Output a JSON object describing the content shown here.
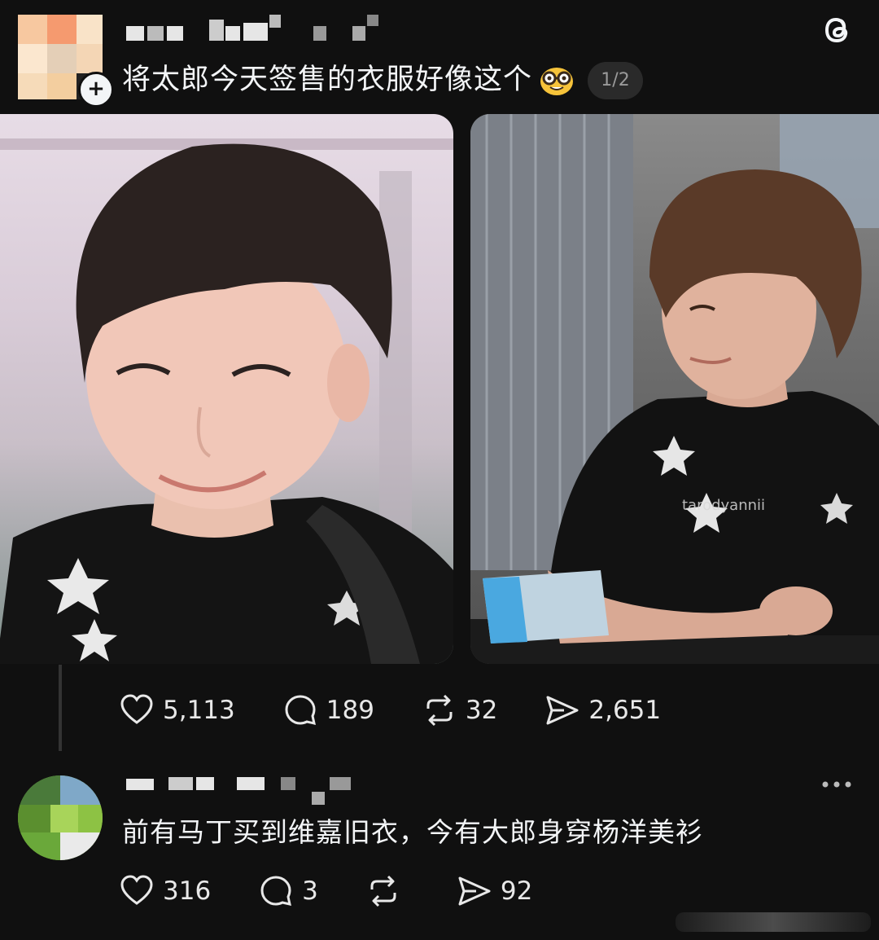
{
  "post": {
    "text": "将太郎今天签售的衣服好像这个",
    "emoji": "nerd-face-emoji",
    "page_indicator": "1/2",
    "media": [
      {
        "name": "photo-left"
      },
      {
        "name": "photo-right",
        "watermark": "tarodyannii"
      }
    ],
    "stats": {
      "likes": "5,113",
      "comments": "189",
      "reposts": "32",
      "shares": "2,651"
    }
  },
  "reply": {
    "text": "前有马丁买到维嘉旧衣，今有大郎身穿杨洋美衫",
    "stats": {
      "likes": "316",
      "comments": "3",
      "reposts": "",
      "shares": "92"
    }
  },
  "colors": {
    "background": "#101010",
    "text": "#f3f5f7",
    "muted": "#9a9a9a"
  }
}
